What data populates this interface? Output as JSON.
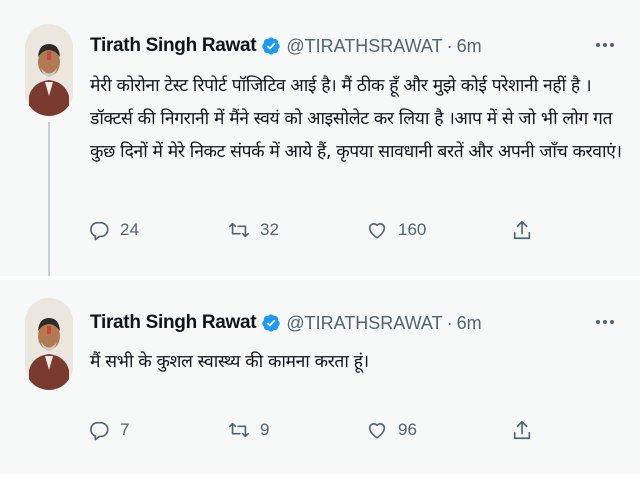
{
  "tweets": [
    {
      "author": {
        "name": "Tirath Singh Rawat",
        "handle": "@TIRATHSRAWAT",
        "separator": "·",
        "time": "6m",
        "verified": true
      },
      "text": "मेरी कोरोना टेस्ट रिपोर्ट पॉजिटिव आई है। मैं ठीक हूँ और मुझे कोई परेशानी नहीं है ।\nडॉक्टर्स की निगरानी में मैंने स्वयं को आइसोलेट कर लिया है ।आप में से जो भी लोग गत\nकुछ दिनों में मेरे निकट संपर्क में आये हैं, कृपया सावधानी बरतें और अपनी जाँच करवाएं।",
      "stats": {
        "replies": "24",
        "retweets": "32",
        "likes": "160"
      }
    },
    {
      "author": {
        "name": "Tirath Singh Rawat",
        "handle": "@TIRATHSRAWAT",
        "separator": "·",
        "time": "6m",
        "verified": true
      },
      "text": "मैं सभी के कुशल स्वास्थ्य की कामना करता हूं।",
      "stats": {
        "replies": "7",
        "retweets": "9",
        "likes": "96"
      }
    }
  ],
  "icons": {
    "verified": "verified-badge-icon",
    "more": "more-options-icon",
    "reply": "reply-icon",
    "retweet": "retweet-icon",
    "like": "like-icon",
    "share": "share-icon"
  },
  "colors": {
    "accent": "#1d9bf0",
    "muted_text": "#536471",
    "text": "#0f1419",
    "background": "#f7f9f9",
    "thread_line": "#c9d1d7"
  }
}
